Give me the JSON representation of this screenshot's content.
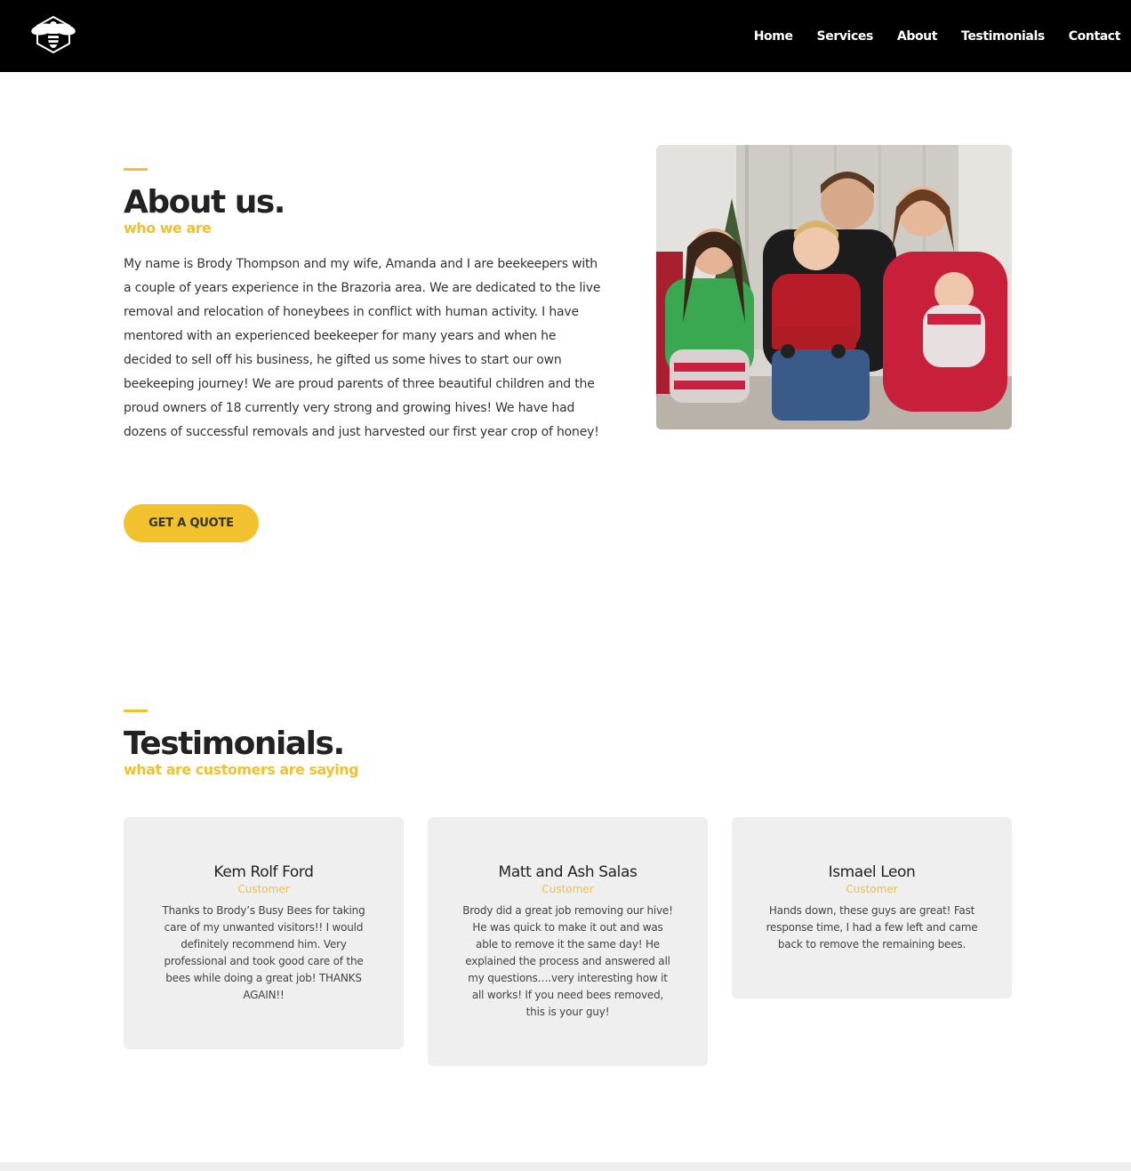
{
  "nav": {
    "logo_icon": "bee-icon",
    "items": [
      {
        "label": "Home"
      },
      {
        "label": "Services"
      },
      {
        "label": "About"
      },
      {
        "label": "Testimonials"
      },
      {
        "label": "Contact"
      }
    ]
  },
  "about": {
    "title": "About us.",
    "subtitle": "who we are",
    "body": "My name is Brody Thompson and my wife, Amanda and I are beekeepers with a couple of years experience in the Brazoria area. We are dedicated to the live removal and relocation of honeybees in conflict with human activity. I have mentored with an experienced beekeeper for many years and when he decided to sell off his business, he gifted us some hives to start our own beekeeping journey! We are proud parents of three beautiful children and the proud owners of 18 currently very strong and growing hives! We have had dozens of successful removals and just harvested our first year crop of honey!",
    "button_label": "GET A QUOTE",
    "photo": "family-photo"
  },
  "testimonials": {
    "title": "Testimonials.",
    "subtitle": "what are customers are saying",
    "items": [
      {
        "name": "Kem Rolf Ford",
        "role": "Customer",
        "text": "Thanks to Brody’s Busy Bees for taking care of my unwanted visitors!! I would definitely recommend him. Very professional and took good care of the bees while doing a great job! THANKS AGAIN!!"
      },
      {
        "name": "Matt and Ash Salas",
        "role": "Customer",
        "text": "Brody did a great job removing our hive! He was quick to make it out and was able to remove it the same day! He explained the process and answered all my questions….very interesting how it all works! If you need bees removed, this is your guy!"
      },
      {
        "name": "Ismael Leon",
        "role": "Customer",
        "text": "Hands down, these guys are great! Fast response time, I had a few left and came back to remove the remaining bees."
      }
    ]
  },
  "colors": {
    "accent": "#f2c12e",
    "header_bg": "#000000",
    "card_bg": "#efefef",
    "heading": "#222222"
  }
}
